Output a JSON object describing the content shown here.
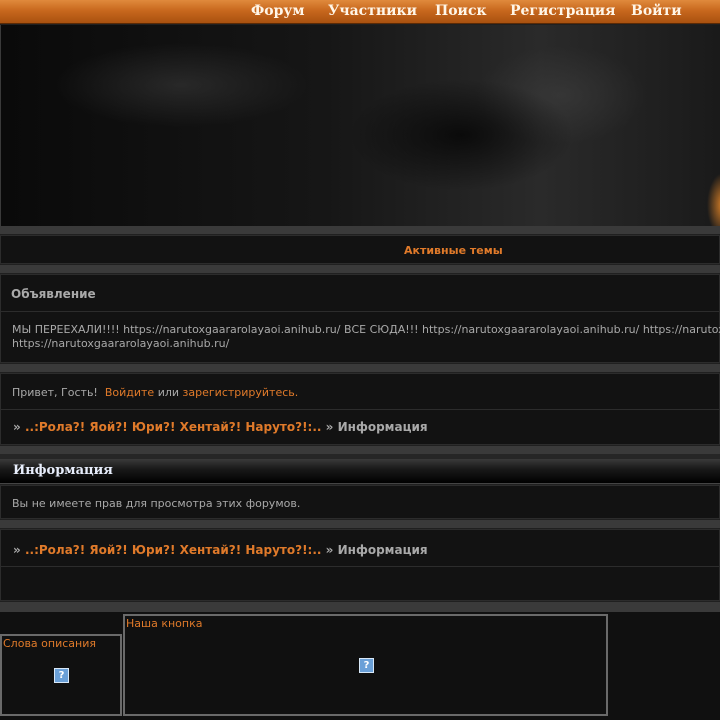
{
  "nav": {
    "items": [
      "Форум",
      "Участники",
      "Поиск",
      "Регистрация",
      "Войти"
    ]
  },
  "active_topics": "Активные темы",
  "announcement": {
    "title": "Объявление",
    "line1": "МЫ ПЕРЕЕХАЛИ!!!! https://narutoxgaararolayaoi.anihub.ru/ ВСЕ СЮДА!!! https://narutoxgaararolayaoi.anihub.ru/ https://narutoxgaararolayaoi.anihub.ru/",
    "line2": "https://narutoxgaararolayaoi.anihub.ru/"
  },
  "greeting": {
    "prefix": "Привет, Гость!",
    "login": "Войдите",
    "or": "или",
    "register": "зарегистрируйтесь."
  },
  "breadcrumb": {
    "sep": "»",
    "forum": "..:Рола?! Яой?! Юри?! Хентай?! Наруто?!:..",
    "sep2": "»",
    "current": "Информация"
  },
  "info": {
    "title": "Информация",
    "message": "Вы не имеете прав для просмотра этих форумов."
  },
  "footer": {
    "words_label": "Слова описания",
    "button_label": "Наша кнопка",
    "icon_glyph": "?"
  }
}
